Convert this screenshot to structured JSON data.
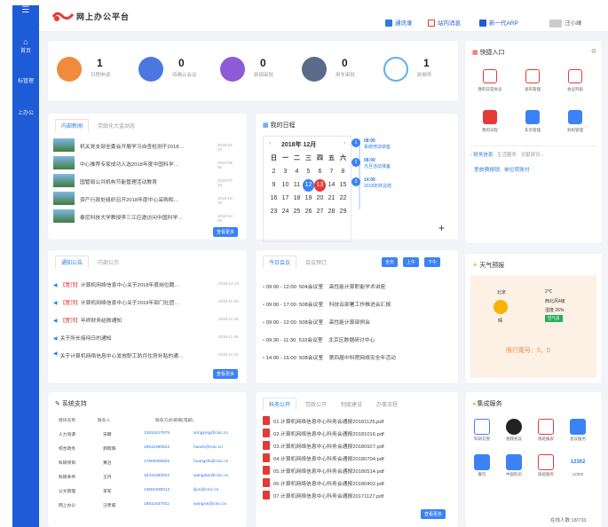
{
  "header": {
    "title": "网上办公平台",
    "links": [
      "通讯录",
      "站内消息",
      "新一代ARP"
    ],
    "user": "汪小峰"
  },
  "sidebar": {
    "items": [
      "首页",
      "标管理",
      "上办公"
    ]
  },
  "stats": [
    {
      "num": "1",
      "label": "日程申请",
      "color": "#f08a3c"
    },
    {
      "num": "0",
      "label": "待确认会议",
      "color": "#4a78e0"
    },
    {
      "num": "0",
      "label": "新闻审批",
      "color": "#8d5bd6"
    },
    {
      "num": "0",
      "label": "用车审批",
      "color": "#5a6c8a"
    },
    {
      "num": "1",
      "label": "新邮件",
      "color": "#5bb0f0"
    }
  ],
  "news": {
    "tabs": [
      "内部新闻",
      "党政化大监",
      "动态"
    ],
    "more": "查看更多",
    "items": [
      {
        "title": "机关党支部全委会开展学习自查检测于2018…",
        "date": "2018-04-23"
      },
      {
        "title": "中心推荐专家成功入选2018年度中国科学…",
        "date": "2018-06-05"
      },
      {
        "title": "国管局公共机构节能管理活动教育",
        "date": "2018-07-20"
      },
      {
        "title": "资产行政处组织召开2018年度中心采购和…",
        "date": "2018-10-10"
      },
      {
        "title": "泰尼科技大学教授李三江应邀访问中国科学…",
        "date": "2018-10-26"
      }
    ]
  },
  "schedule": {
    "title": "我的日程",
    "month": "2018年 12月",
    "weekdays": [
      "日",
      "一",
      "二",
      "三",
      "四",
      "五",
      "六"
    ],
    "days": [
      [
        "",
        "",
        "",
        "",
        "",
        "",
        ""
      ],
      [
        "2",
        "3",
        "4",
        "5",
        "6",
        "7",
        "8"
      ],
      [
        "9",
        "10",
        "11",
        "12",
        "13",
        "14",
        "15"
      ],
      [
        "16",
        "17",
        "18",
        "19",
        "20",
        "21",
        "22"
      ],
      [
        "23",
        "24",
        "25",
        "26",
        "27",
        "28",
        "29"
      ]
    ],
    "events": [
      {
        "no": "1",
        "time": "08:00",
        "text": "系统培训讲座"
      },
      {
        "no": "2",
        "time": "08:00",
        "text": "元旦活动准备"
      },
      {
        "no": "3",
        "time": "14:00",
        "text": "2018年终总结"
      }
    ]
  },
  "notices": {
    "tabs": [
      "通知公告",
      "内部公示"
    ],
    "more": "查看更多",
    "items": [
      {
        "tag": "【置顶】",
        "title": "计算机网络信息中心关于2018年度岗位聘…",
        "date": "2018-12-13"
      },
      {
        "tag": "【置顶】",
        "title": "计算机网络信息中心关于2018年部门社团…",
        "date": "2018-11-20"
      },
      {
        "tag": "【置顶】",
        "title": "年终财务结账通知",
        "date": "2018-11-26"
      },
      {
        "tag": "",
        "title": "关于所长接待日的通知",
        "date": "2018-11-26"
      },
      {
        "tag": "",
        "title": "关于计算机网络信息中心发放职工防月住房补贴的通…",
        "date": "2018-11-22"
      }
    ]
  },
  "meetings": {
    "tabs": [
      "今日会议",
      "会议预订"
    ],
    "btns": [
      "全天",
      "上午",
      "下午"
    ],
    "items": [
      {
        "time": "09:00 - 12:00",
        "room": "504会议室",
        "topic": "高性能计算职能学术讲座"
      },
      {
        "time": "09:00 - 17:00",
        "room": "508会议室",
        "topic": "科技云部署工作推进会汇报"
      },
      {
        "time": "09:00 - 12:00",
        "room": "508会议室",
        "topic": "高性能计算部例会"
      },
      {
        "time": "09:30 - 11:30",
        "room": "510会议室",
        "topic": "北京区数据研讨中心"
      },
      {
        "time": "14:00 - 16:00",
        "room": "508会议室",
        "topic": "第四届中科院网络安全年活动"
      }
    ]
  },
  "quick": {
    "title": "快捷入口",
    "items": [
      {
        "label": "我的日常会议",
        "color": "#e53935"
      },
      {
        "label": "发布管理",
        "color": "#e53935"
      },
      {
        "label": "会议列表",
        "color": "#e53935"
      },
      {
        "label": "我的日程",
        "color": "#e53935"
      },
      {
        "label": "车务管理",
        "color": "#3b82f6"
      },
      {
        "label": "机构管理",
        "color": "#3b82f6"
      }
    ],
    "subtabs": [
      "财务信息",
      "生活服务",
      "文献资讯"
    ],
    "links": [
      "差旅费报销",
      "单位转账付"
    ]
  },
  "weather": {
    "title": "天气预报",
    "city": "北京",
    "temp": "2℃",
    "wind": "西北风4级",
    "humidity": "湿度 26%",
    "aqi": "空气良",
    "desc": "晴",
    "limit": "限行尾号：5，0"
  },
  "support": {
    "title": "系统支持",
    "headers": [
      "模块名称",
      "联系人",
      "联系方式/邮箱(电邮)"
    ],
    "rows": [
      [
        "人力资源",
        "宋颖",
        "13811617975",
        "songying@cnic.cn"
      ],
      [
        "综合政务",
        "郝晓辉",
        "18611990522",
        "haoxh@cnic.cn"
      ],
      [
        "科研项目",
        "黄治",
        "17600060822",
        "huangzhi@cnic.cn"
      ],
      [
        "科研条件",
        "王丹",
        "15311980022",
        "wangdan@cnic.cn"
      ],
      [
        "公文管理",
        "李军",
        "13691830012",
        "lijun@cnic.cn"
      ],
      [
        "网上办公",
        "汪孝威",
        "18811637011",
        "wangxw@cnic.cn"
      ]
    ]
  },
  "docs": {
    "tabs": [
      "科务公开",
      "党政公开",
      "制度建设",
      "办事流程"
    ],
    "more": "查看更多",
    "items": [
      "01.计算机网络信息中心科务会通报20181125.pdf",
      "02.计算机网络信息中心科务会通报20181016.pdf",
      "03.计算机网络信息中心科务会通报20180927.pdf",
      "04.计算机网络信息中心科务会通报20180704.pdf",
      "05.计算机网络信息中心科务会通报20180514.pdf",
      "06.计算机网络信息中心科务会通报20180402.pdf",
      "07.计算机网络信息中心科务会通报20171127.pdf"
    ]
  },
  "services": {
    "title": "集成服务",
    "items": [
      {
        "label": "科研云盘",
        "color": "#3b82f6"
      },
      {
        "label": "视频会议",
        "color": "#222"
      },
      {
        "label": "值班报表",
        "color": "#e53935"
      },
      {
        "label": "会议服务",
        "color": "#3b82f6"
      },
      {
        "label": "餐饮",
        "color": "#3b82f6"
      },
      {
        "label": "中国科讯",
        "color": "#3b82f6"
      },
      {
        "label": "值班服务",
        "color": "#e53935"
      },
      {
        "label": "12302",
        "color": "#2a7be4"
      }
    ],
    "online": "在线人数:18/733"
  }
}
